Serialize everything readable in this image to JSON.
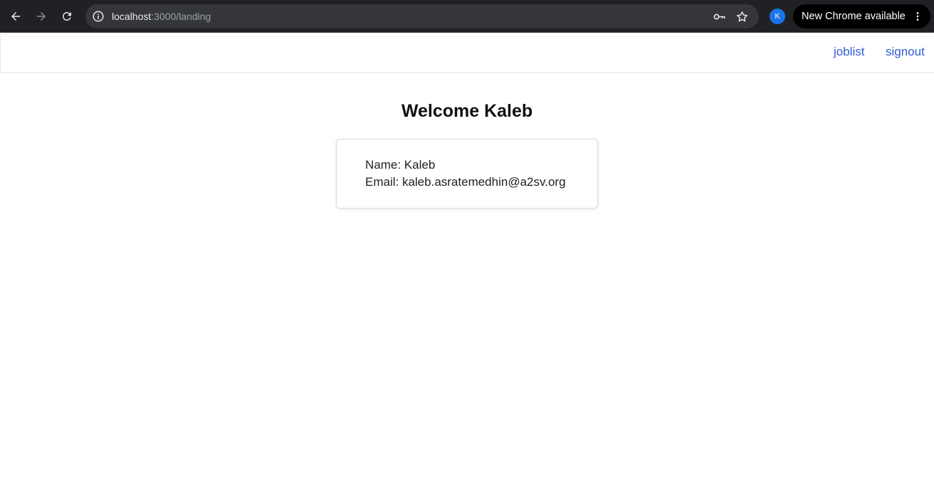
{
  "browser": {
    "url_host": "localhost",
    "url_path": ":3000/landing",
    "profile_initial": "K",
    "update_label": "New Chrome available",
    "icons": {
      "back": "arrow-left-icon",
      "forward": "arrow-right-icon",
      "reload": "reload-icon",
      "site_info": "info-icon",
      "password": "key-icon",
      "bookmark": "star-icon",
      "more": "more-vertical-icon"
    }
  },
  "nav": {
    "joblist_label": "joblist",
    "signout_label": "signout",
    "link_color": "#2f5bd3"
  },
  "main": {
    "heading": "Welcome Kaleb",
    "card": {
      "name_line": "Name: Kaleb",
      "email_line": "Email: kaleb.asratemedhin@a2sv.org"
    }
  }
}
